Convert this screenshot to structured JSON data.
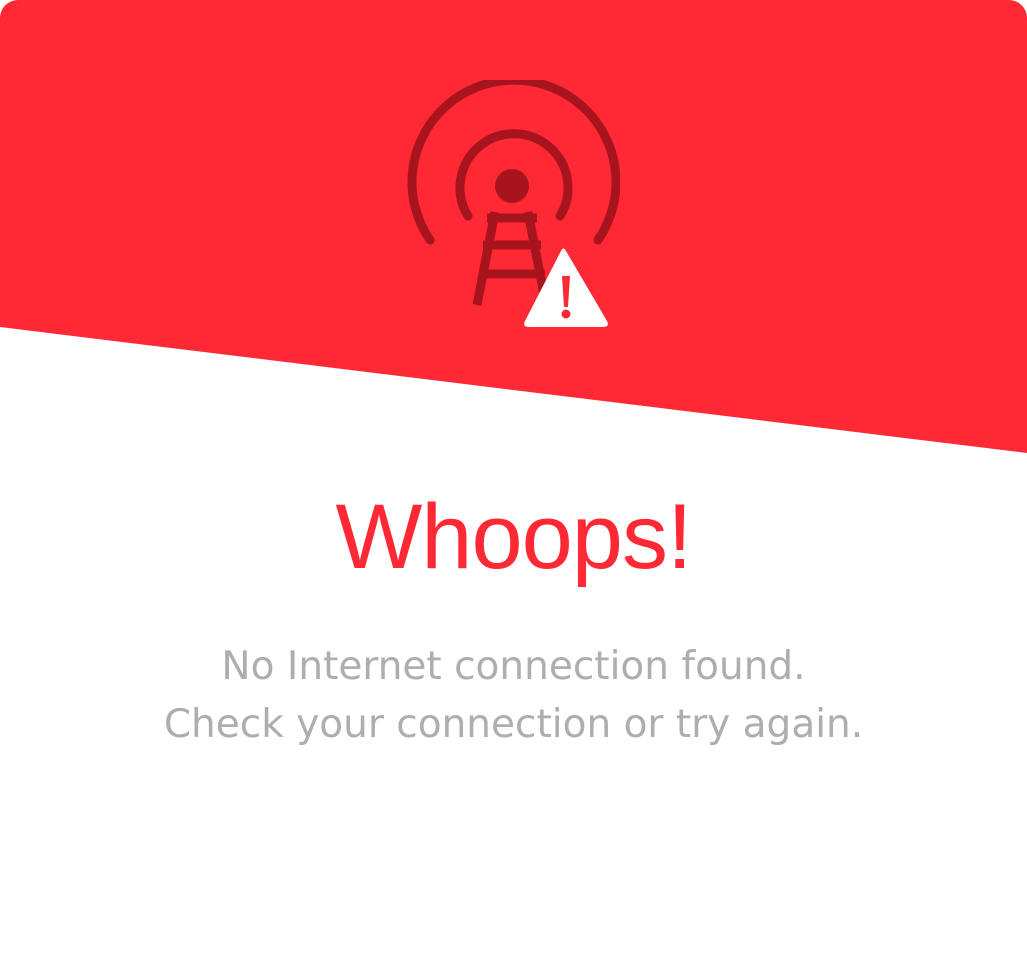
{
  "colors": {
    "accent": "#ff2936",
    "icon_dark": "#a8141d",
    "warning_fill": "#ffffff",
    "body_text": "#aeaeae",
    "background": "#ffffff"
  },
  "icons": {
    "main": "radio-tower-icon",
    "badge": "warning-triangle-icon"
  },
  "error": {
    "title": "Whoops!",
    "line1": "No Internet connection found.",
    "line2": "Check your connection or try again."
  }
}
